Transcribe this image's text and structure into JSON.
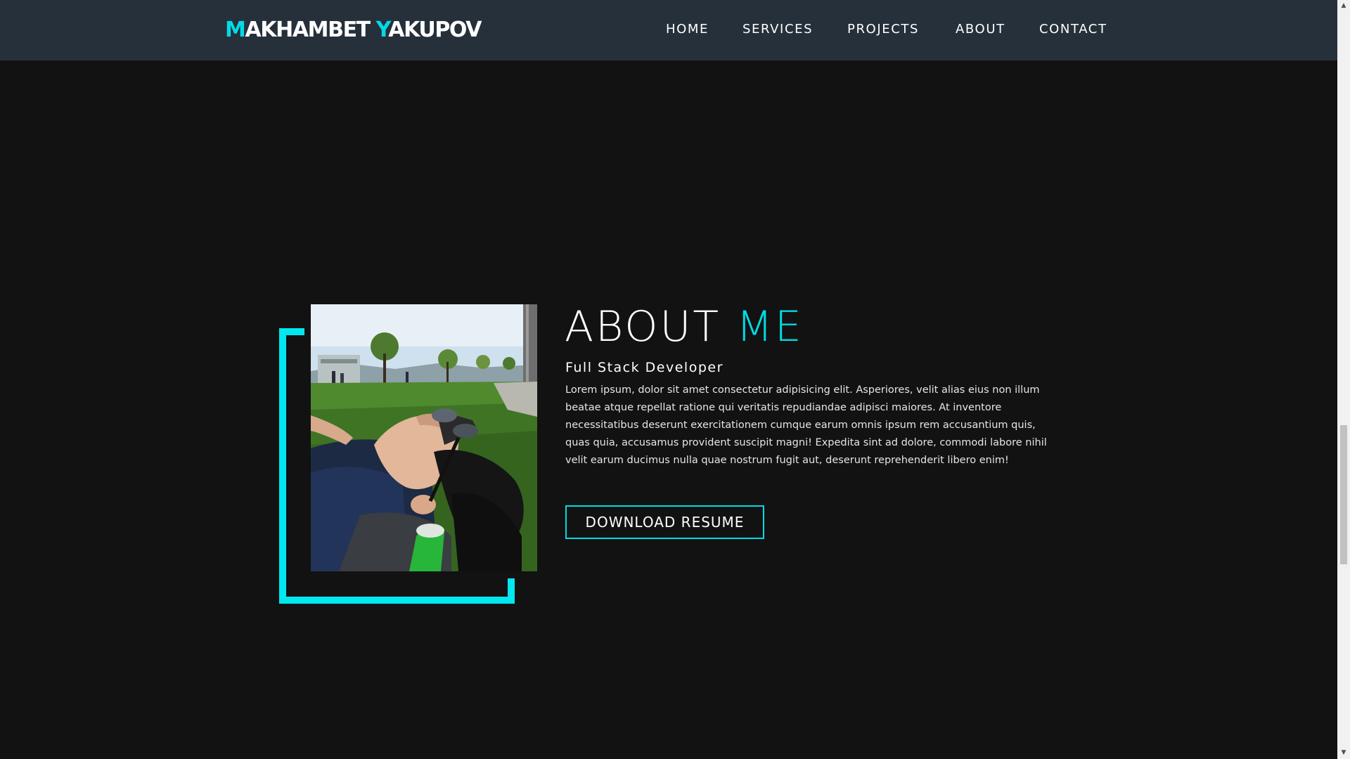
{
  "header": {
    "logo_first_initial": "M",
    "logo_first_rest": "AKHAMBET",
    "logo_last_initial": "Y",
    "logo_last_rest": "AKUPOV",
    "nav": {
      "home": "HOME",
      "services": "SERVICES",
      "projects": "PROJECTS",
      "about": "ABOUT",
      "contact": "CONTACT"
    }
  },
  "about": {
    "title_main": "ABOUT",
    "title_accent": "ME",
    "subtitle": "Full Stack Developer",
    "bio": "Lorem ipsum, dolor sit amet consectetur adipisicing elit. Asperiores, velit alias eius non illum beatae atque repellat ratione qui veritatis repudiandae adipisci maiores. At inventore necessitatibus deserunt exercitationem cumque earum omnis ipsum rem accusantium quis, quas quia, accusamus provident suscipit magni! Expedita sint ad dolore, commodi labore nihil velit earum ducimus nulla quae nostrum fugit aut, deserunt reprehenderit libero enim!",
    "resume_button": "DOWNLOAD RESUME"
  },
  "colors": {
    "accent": "#00dbe6",
    "frame": "#00e8f0",
    "background": "#121212",
    "navbar": "#26303b"
  },
  "icons": {
    "scroll_up": "triangle-up-icon",
    "scroll_down": "triangle-down-icon"
  }
}
